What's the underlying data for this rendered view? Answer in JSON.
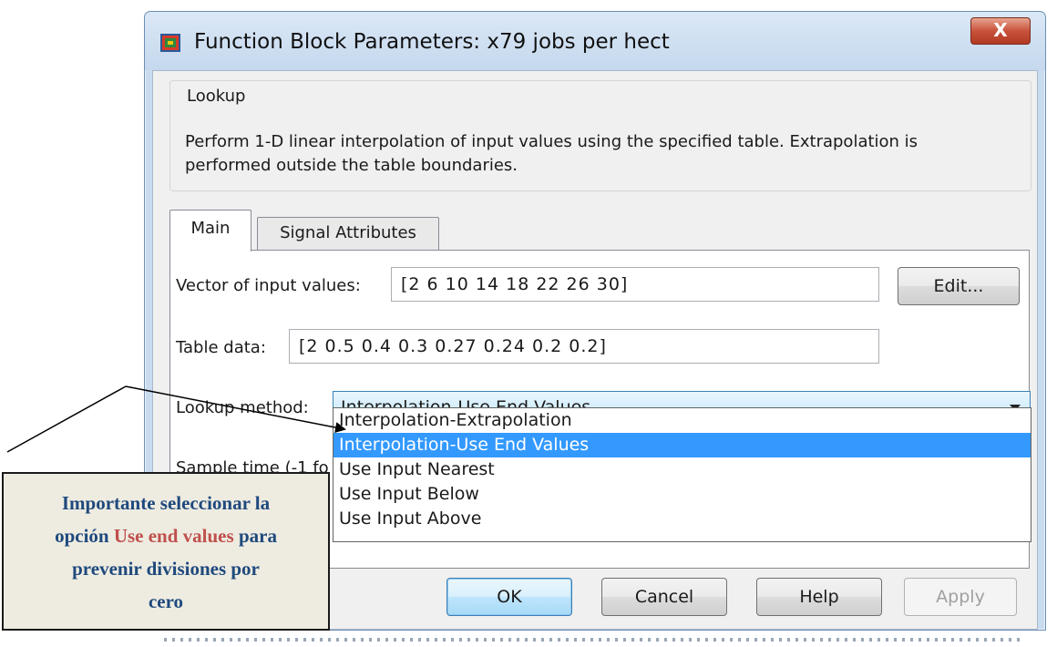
{
  "window": {
    "title": "Function Block Parameters: x79 jobs per hect",
    "close_glyph": "X"
  },
  "group": {
    "title": "Lookup",
    "description": "Perform 1-D linear interpolation of input values using the specified table.  Extrapolation is performed outside the table boundaries."
  },
  "tabs": [
    {
      "label": "Main",
      "active": true
    },
    {
      "label": "Signal Attributes",
      "active": false
    }
  ],
  "main": {
    "vector_label": "Vector of input values:",
    "vector_value": "[2 6 10 14 18 22 26 30]",
    "edit_label": "Edit...",
    "table_label": "Table data:",
    "table_value": "[2 0.5 0.4 0.3 0.27 0.24 0.2 0.2]",
    "method_label": "Lookup method:",
    "method_value": "Interpolation-Use End Values",
    "sample_label": "Sample time (-1 fo",
    "method_options": [
      "Interpolation-Extrapolation",
      "Interpolation-Use End Values",
      "Use Input Nearest",
      "Use Input Below",
      "Use Input Above"
    ]
  },
  "buttons": {
    "ok": "OK",
    "cancel": "Cancel",
    "help": "Help",
    "apply": "Apply"
  },
  "note": {
    "line1": "Importante seleccionar la",
    "line2_pre": "opción ",
    "line2_accent": "Use end values",
    "line2_post": " para",
    "line3": "prevenir divisiones por",
    "line4": "cero"
  },
  "colors": {
    "note_text": "#1f497d",
    "note_accent": "#c0504d",
    "selection": "#3399ff"
  }
}
